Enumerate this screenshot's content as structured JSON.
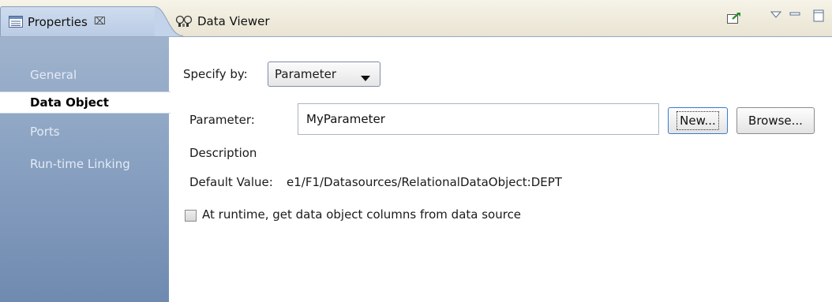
{
  "tabs": [
    {
      "label": "Properties",
      "close_glyph": "⌧",
      "icon": "properties-icon"
    },
    {
      "label": "Data Viewer",
      "icon": "data-viewer-icon"
    }
  ],
  "toolbar_icons": [
    "pin-icon",
    "view-menu-icon",
    "minimize-icon",
    "maximize-icon"
  ],
  "sidebar": {
    "items": [
      {
        "label": "General",
        "active": false
      },
      {
        "label": "Data Object",
        "active": true
      },
      {
        "label": "Ports",
        "active": false
      },
      {
        "label": "Run-time Linking",
        "active": false
      }
    ]
  },
  "form": {
    "specify_by_label": "Specify by:",
    "specify_by_value": "Parameter",
    "parameter_label": "Parameter:",
    "parameter_value": "MyParameter",
    "new_button": "New...",
    "browse_button": "Browse...",
    "description_label": "Description",
    "default_value_label": "Default Value:",
    "default_value": "e1/F1/Datasources/RelationalDataObject:DEPT",
    "runtime_checkbox_label": "At runtime, get data object columns from data source",
    "runtime_checked": false
  },
  "colors": {
    "sidebar_top": "#9fb3cd",
    "sidebar_bottom": "#6f8ab0",
    "active_tab": "#cfdcee",
    "tabbar": "#f1eddd"
  }
}
